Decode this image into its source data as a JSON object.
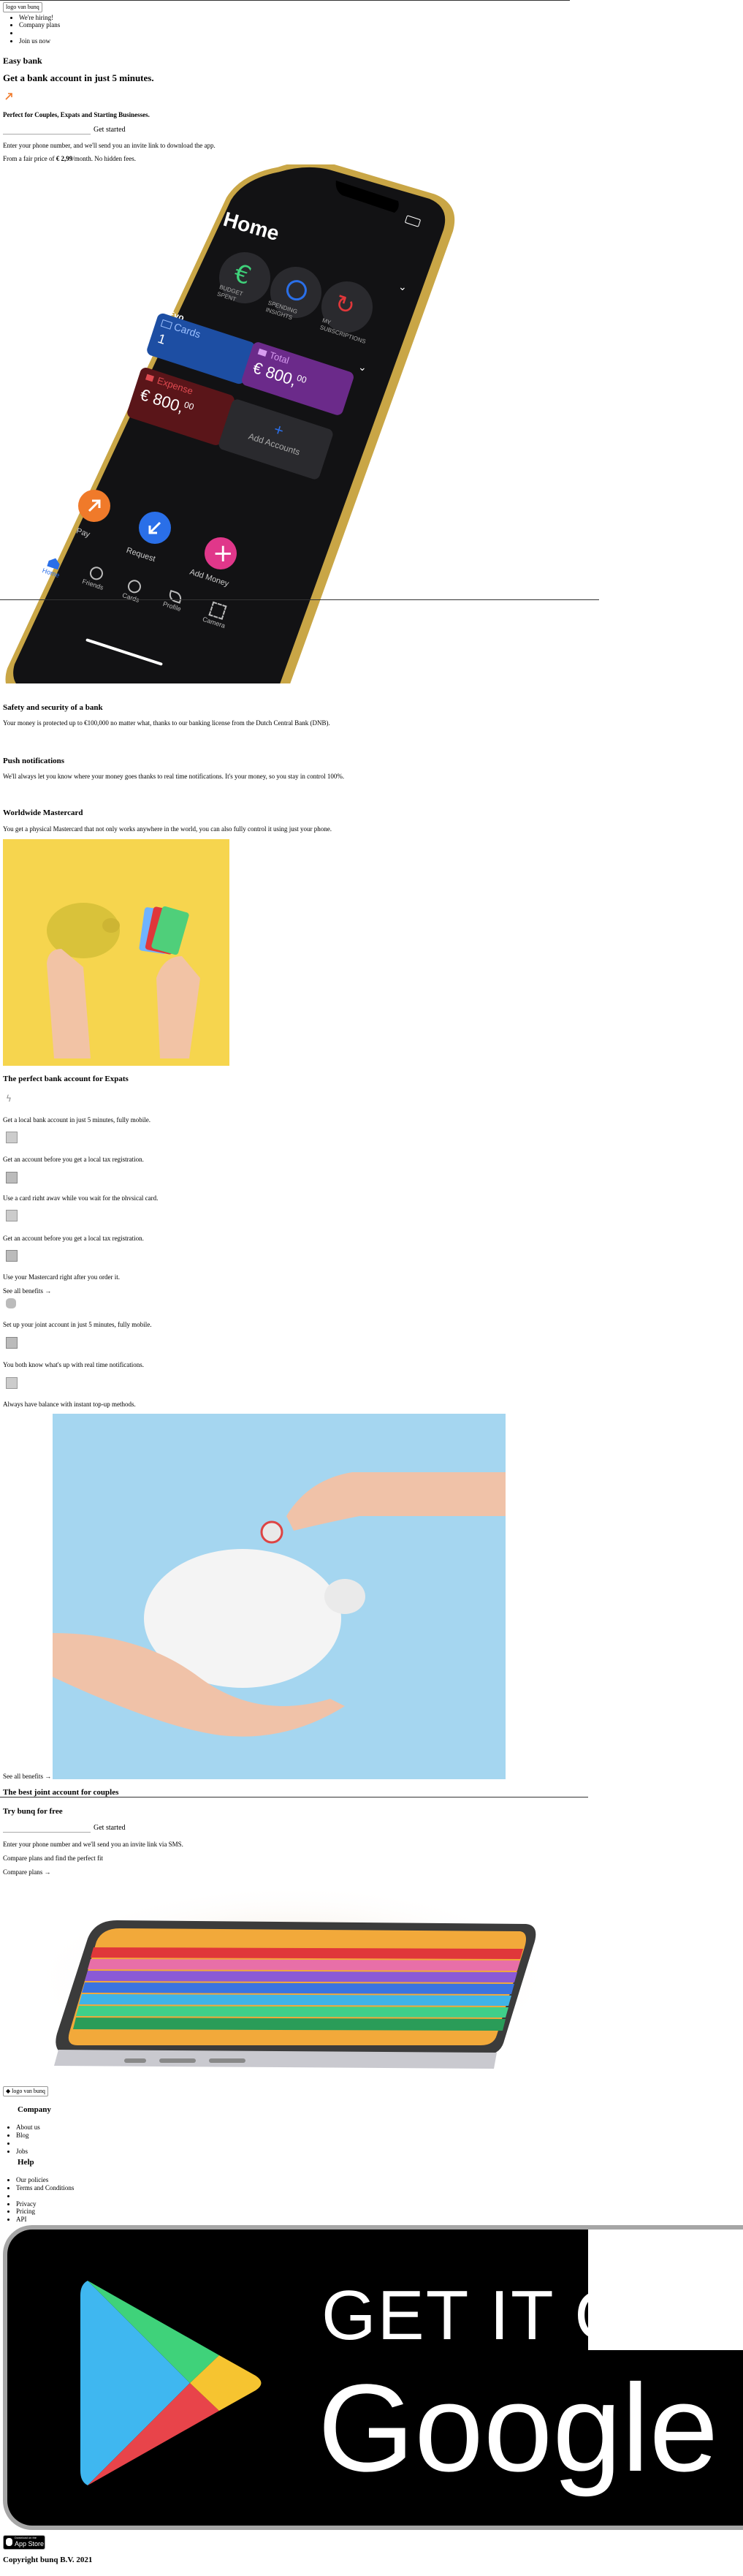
{
  "header": {
    "logo_alt": "logo van bunq",
    "nav": [
      "We're hiring!",
      "Company plans",
      "Join us now"
    ]
  },
  "hero": {
    "title": "Easy bank",
    "subtitle": "Get a bank account in just 5 minutes.",
    "tagline": "Perfect for Couples, Expats and Starting Businesses.",
    "cta_button": "Get started",
    "invite_text": "Enter your phone number, and we'll send you an invite link to download the app.",
    "price_prefix": "From a fair price of ",
    "price_value": "€ 2,99",
    "price_suffix": "/month. No hidden fees."
  },
  "phone_app": {
    "screen_title": "Home",
    "quick_actions": [
      "BUDGET SPENT",
      "SPENDING INSIGHTS",
      "MY SUBSCRIPTIONS"
    ],
    "user": "Evo",
    "cards_label": "Cards",
    "cards_count": "1",
    "total_label": "Total",
    "total_amount": "€ 800,",
    "total_cents": "00",
    "account_label": "Expense",
    "account_amount": "€ 800,",
    "account_cents": "00",
    "add_accounts": "Add Accounts",
    "actions": [
      "Pay",
      "Request",
      "Add Money"
    ],
    "tabs": [
      "Home",
      "Friends",
      "Cards",
      "Profile",
      "Camera"
    ],
    "colors": {
      "pay": "#f07a2a",
      "request": "#2a6fe8",
      "add": "#e0378a",
      "cards": "#1d4ea3",
      "total": "#6b2a8a",
      "expense": "#b0252e"
    }
  },
  "features": [
    {
      "title": "Safety and security of a bank",
      "text": "Your money is protected up to €100,000 no matter what, thanks to our banking license from the Dutch Central Bank (DNB)."
    },
    {
      "title": "Push notifications",
      "text": "We'll always let you know where your money goes thanks to real time notifications. It's your money, so you stay in control 100%."
    },
    {
      "title": "Worldwide Mastercard",
      "text": "You get a physical Mastercard that not only works anywhere in the world, you can also fully control it using just your phone."
    }
  ],
  "expats": {
    "title": "The perfect bank account for Expats",
    "benefits": [
      "Get a local bank account in just 5 minutes, fully mobile.",
      "Get an account before you get a local tax registration.",
      "Use a card right away while you wait for the physical card.",
      "Get an account before you get a local tax registration.",
      "Use your Mastercard right after you order it."
    ],
    "see_all": "See all benefits →"
  },
  "couples": {
    "benefits": [
      "Set up your joint account in just 5 minutes, fully mobile.",
      "You both know what's up with real time notifications.",
      "Always have balance with instant top-up methods."
    ],
    "see_all": "See all benefits →",
    "title": "The best joint account for couples"
  },
  "try": {
    "title": "Try bunq for free",
    "cta_button": "Get started",
    "invite_text": "Enter your phone number and we'll send you an invite link via SMS.",
    "compare_text": "Compare plans and find the perfect fit",
    "compare_link": "Compare plans →"
  },
  "footer": {
    "logo_alt": "logo van bunq",
    "company_title": "Company",
    "company_links": [
      "About us",
      "Blog",
      "",
      "Jobs"
    ],
    "help_title": "Help",
    "help_links": [
      "Our policies",
      "Terms and Conditions",
      "",
      "Privacy",
      "Pricing",
      "API"
    ],
    "google_play_line1": "GET IT ON",
    "google_play_line2": "Google Play",
    "app_store_line1": "Download on the",
    "app_store_line2": "App Store",
    "copyright": "Copyright bunq B.V. 2021"
  }
}
